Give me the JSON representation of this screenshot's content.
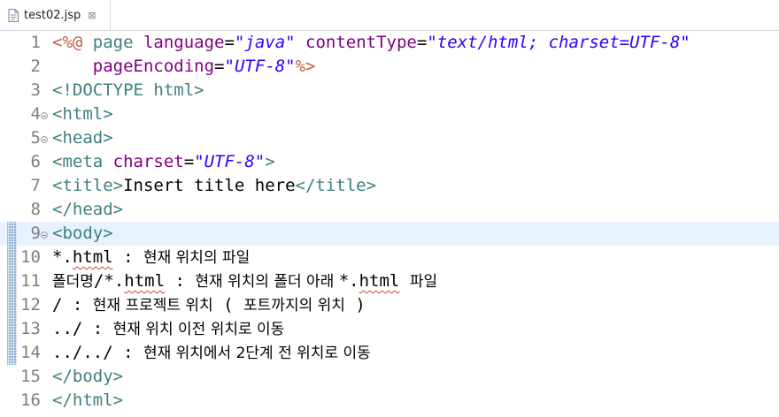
{
  "tab": {
    "filename": "test02.jsp",
    "close_glyph": "⊠"
  },
  "colors": {
    "jsp_directive": "#bf5f3f",
    "tag": "#3f7f7f",
    "attribute": "#7f007f",
    "string": "#2a00ff",
    "text": "#000000",
    "line_number": "#7f7f7f",
    "current_line": "#e8f2fe"
  },
  "icons": {
    "file": "file-icon",
    "close": "close-icon",
    "fold": "fold-collapse-icon"
  },
  "editor": {
    "lines": [
      {
        "number": "1",
        "segments": [
          {
            "text": "<%@",
            "type": "jsp"
          },
          {
            "text": " page ",
            "type": "tag"
          },
          {
            "text": "language",
            "type": "attr"
          },
          {
            "text": "=",
            "type": "plain"
          },
          {
            "text": "\"java\"",
            "type": "str"
          },
          {
            "text": " ",
            "type": "plain"
          },
          {
            "text": "contentType",
            "type": "attr"
          },
          {
            "text": "=",
            "type": "plain"
          },
          {
            "text": "\"text/html; charset=UTF-8\"",
            "type": "str"
          }
        ]
      },
      {
        "number": "2",
        "segments": [
          {
            "text": "    ",
            "type": "plain"
          },
          {
            "text": "pageEncoding",
            "type": "attr"
          },
          {
            "text": "=",
            "type": "plain"
          },
          {
            "text": "\"UTF-8\"",
            "type": "str"
          },
          {
            "text": "%>",
            "type": "jsp"
          }
        ]
      },
      {
        "number": "3",
        "segments": [
          {
            "text": "<!DOCTYPE html>",
            "type": "tag"
          }
        ]
      },
      {
        "number": "4",
        "fold": true,
        "segments": [
          {
            "text": "<html>",
            "type": "tag"
          }
        ]
      },
      {
        "number": "5",
        "fold": true,
        "segments": [
          {
            "text": "<head>",
            "type": "tag"
          }
        ]
      },
      {
        "number": "6",
        "segments": [
          {
            "text": "<meta ",
            "type": "tag"
          },
          {
            "text": "charset",
            "type": "attr"
          },
          {
            "text": "=",
            "type": "plain"
          },
          {
            "text": "\"UTF-8\"",
            "type": "str"
          },
          {
            "text": ">",
            "type": "tag"
          }
        ]
      },
      {
        "number": "7",
        "segments": [
          {
            "text": "<title>",
            "type": "tag"
          },
          {
            "text": "Insert title here",
            "type": "plain"
          },
          {
            "text": "</title>",
            "type": "tag"
          }
        ]
      },
      {
        "number": "8",
        "segments": [
          {
            "text": "</head>",
            "type": "tag"
          }
        ]
      },
      {
        "number": "9",
        "fold": true,
        "current": true,
        "changed": true,
        "segments": [
          {
            "text": "<body>",
            "type": "tag"
          }
        ]
      },
      {
        "number": "10",
        "changed": true,
        "segments": [
          {
            "text": "*.",
            "type": "plain"
          },
          {
            "text": "html",
            "type": "plain",
            "squiggle": true
          },
          {
            "text": " : ",
            "type": "plain"
          },
          {
            "text": "현재 위치의 파일",
            "type": "ko"
          }
        ]
      },
      {
        "number": "11",
        "changed": true,
        "segments": [
          {
            "text": "폴더명",
            "type": "ko"
          },
          {
            "text": "/*.",
            "type": "plain"
          },
          {
            "text": "html",
            "type": "plain",
            "squiggle": true
          },
          {
            "text": " : ",
            "type": "plain"
          },
          {
            "text": "현재 위치의 폴더 아래 ",
            "type": "ko"
          },
          {
            "text": "*.",
            "type": "plain"
          },
          {
            "text": "html",
            "type": "plain",
            "squiggle": true
          },
          {
            "text": " ",
            "type": "plain"
          },
          {
            "text": "파일",
            "type": "ko"
          }
        ]
      },
      {
        "number": "12",
        "changed": true,
        "segments": [
          {
            "text": "/ : ",
            "type": "plain"
          },
          {
            "text": "현재 프로젝트 위치",
            "type": "ko"
          },
          {
            "text": " ( ",
            "type": "plain"
          },
          {
            "text": "포트까지의 위치",
            "type": "ko"
          },
          {
            "text": " )",
            "type": "plain"
          }
        ]
      },
      {
        "number": "13",
        "changed": true,
        "segments": [
          {
            "text": "../ : ",
            "type": "plain"
          },
          {
            "text": "현재 위치 이전 위치로 이동",
            "type": "ko"
          }
        ]
      },
      {
        "number": "14",
        "changed": true,
        "segments": [
          {
            "text": "../../ : ",
            "type": "plain"
          },
          {
            "text": "현재 위치에서 2단계 전 위치로 이동",
            "type": "ko"
          }
        ]
      },
      {
        "number": "15",
        "segments": [
          {
            "text": "</body>",
            "type": "tag"
          }
        ]
      },
      {
        "number": "16",
        "segments": [
          {
            "text": "</html>",
            "type": "tag"
          }
        ]
      }
    ]
  }
}
